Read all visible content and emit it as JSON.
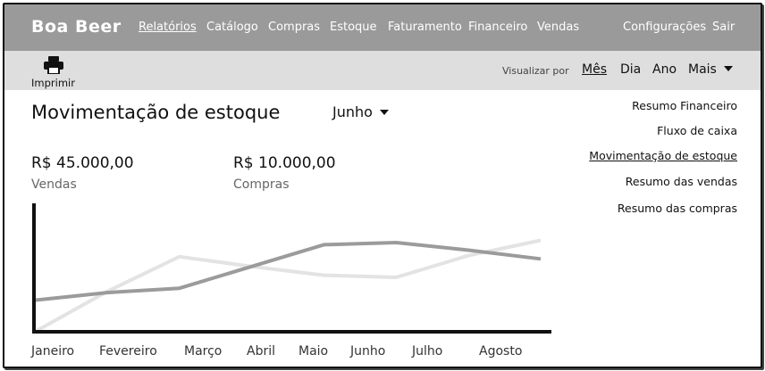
{
  "app": {
    "brand": "Boa Beer"
  },
  "nav": {
    "items": [
      "Relatórios",
      "Catálogo",
      "Compras",
      "Estoque",
      "Faturamento",
      "Financeiro",
      "Vendas"
    ],
    "settings": "Configurações",
    "logout": "Sair"
  },
  "toolbar": {
    "print_label": "Imprimir",
    "view_by_label": "Visualizar por",
    "periods": [
      "Mês",
      "Dia",
      "Ano",
      "Mais"
    ]
  },
  "page": {
    "title": "Movimentação de estoque",
    "month": "Junho"
  },
  "kpis": [
    {
      "value": "R$ 45.000,00",
      "label": "Vendas"
    },
    {
      "value": "R$ 10.000,00",
      "label": "Compras"
    }
  ],
  "side_links": [
    "Resumo Financeiro",
    "Fluxo de caixa",
    "Movimentação de estoque",
    "Resumo das vendas",
    "Resumo das compras"
  ],
  "colors": {
    "nav_bg": "#9a9a9a",
    "toolbar_bg": "#dedede",
    "series_dark": "#9b9b9b",
    "series_light": "#e3e3e3"
  },
  "chart_data": {
    "type": "line",
    "categories": [
      "Janeiro",
      "Fevereiro",
      "Março",
      "Abril",
      "Maio",
      "Junho",
      "Julho",
      "Agosto"
    ],
    "ylim": [
      0,
      100
    ],
    "grid": false,
    "series": [
      {
        "values": [
          0,
          37,
          69,
          60,
          52,
          50,
          70,
          84
        ]
      },
      {
        "values": [
          29,
          36,
          40,
          60,
          80,
          82,
          75,
          67
        ]
      }
    ]
  }
}
